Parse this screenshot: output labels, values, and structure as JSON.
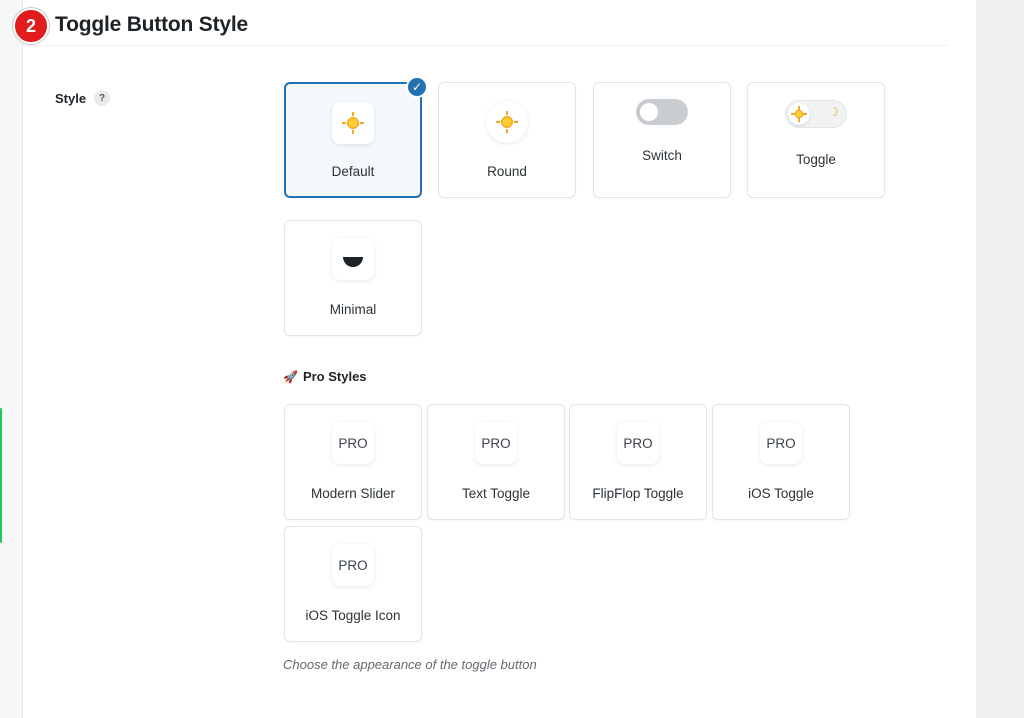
{
  "header": {
    "step_number": "2",
    "title": "Toggle Button Style"
  },
  "field": {
    "label": "Style",
    "help_icon": "?"
  },
  "styles": {
    "selected": "Default",
    "items": [
      {
        "label": "Default",
        "icon": "sun-icon"
      },
      {
        "label": "Round",
        "icon": "sun-icon"
      },
      {
        "label": "Switch",
        "icon": "switch-icon"
      },
      {
        "label": "Toggle",
        "icon": "sun-moon-toggle-icon"
      },
      {
        "label": "Minimal",
        "icon": "half-moon-icon"
      }
    ]
  },
  "pro_section": {
    "icon": "🚀",
    "title": "Pro Styles",
    "badge": "PRO",
    "items": [
      {
        "label": "Modern Slider"
      },
      {
        "label": "Text Toggle"
      },
      {
        "label": "FlipFlop Toggle"
      },
      {
        "label": "iOS Toggle"
      },
      {
        "label": "iOS Toggle Icon"
      }
    ]
  },
  "description": "Choose the appearance of the toggle button",
  "colors": {
    "accent": "#2271b1",
    "step_badge": "#e21c1c",
    "side_accent": "#22c55e"
  }
}
